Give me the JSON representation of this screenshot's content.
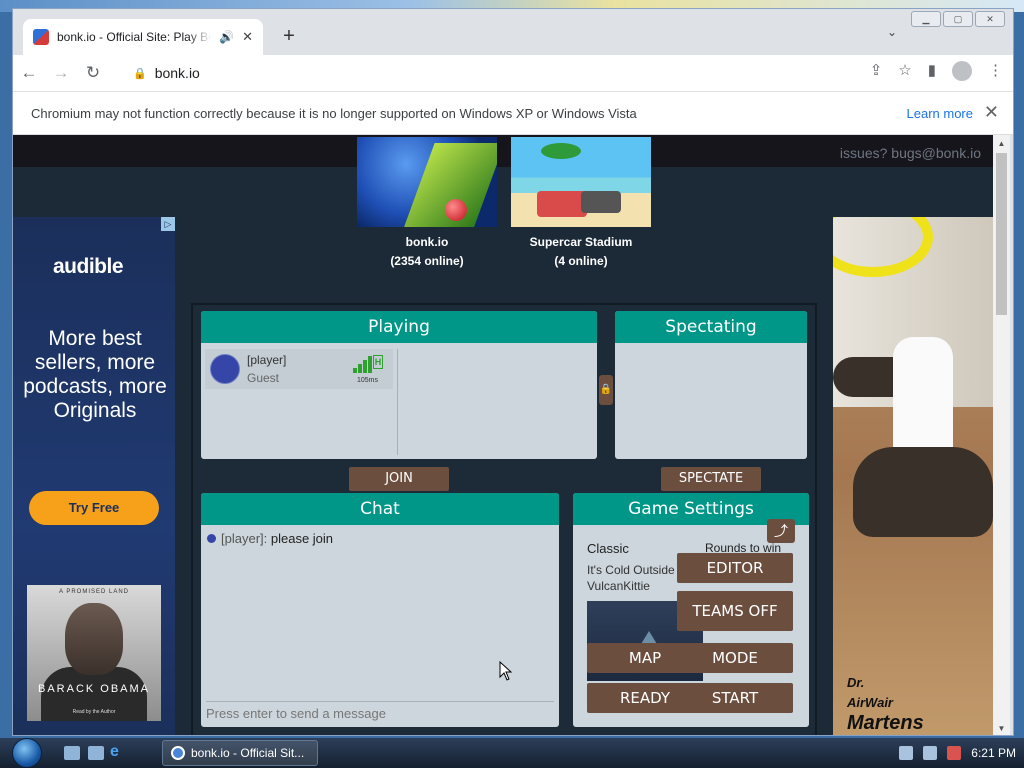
{
  "browser": {
    "tab_title": "bonk.io - Official Site: Play Bonk",
    "tab_audio_icon": "speaker-icon",
    "new_tab": "+",
    "url": "bonk.io",
    "infobar_text": "Chromium may not function correctly because it is no longer supported on Windows XP or Windows Vista",
    "learn_more": "Learn more"
  },
  "site": {
    "issues": "issues? bugs@bonk.io",
    "games": [
      {
        "name": "bonk.io",
        "online": "(2354 online)"
      },
      {
        "name": "Supercar Stadium",
        "online": "(4 online)"
      }
    ]
  },
  "ad_left": {
    "brand": "audible",
    "copy": "More best sellers, more podcasts, more Originals",
    "cta": "Try Free",
    "book_top": "A PROMISED LAND",
    "book_name": "BARACK OBAMA",
    "book_sub": "Read by the Author"
  },
  "ad_right": {
    "brand_line1": "Dr.",
    "brand_line2": "AirWair",
    "brand_line3": "Martens"
  },
  "lobby": {
    "playing_title": "Playing",
    "spectating_title": "Spectating",
    "player": {
      "name": "[player]",
      "rank": "Guest",
      "ping": "105ms"
    },
    "join": "JOIN",
    "spectate": "SPECTATE",
    "chat_title": "Chat",
    "chat_messages": [
      {
        "author": "[player]:",
        "text": "please join"
      }
    ],
    "chat_placeholder": "Press enter to send a message",
    "settings_title": "Game Settings",
    "mode": "Classic",
    "rounds": "Rounds to win",
    "map_name": "It's Cold Outside",
    "map_author": "VulcanKittie",
    "editor": "EDITOR",
    "teams": "TEAMS OFF",
    "map_btn": "MAP",
    "mode_btn": "MODE",
    "ready": "READY",
    "start": "START"
  },
  "taskbar": {
    "window_label": "bonk.io - Official Sit...",
    "clock": "6:21 PM"
  },
  "colors": {
    "teal": "#009688",
    "brown_button": "#6b4e3e",
    "panel_bg": "#cdd6dc",
    "page_bg": "#1c2936"
  }
}
